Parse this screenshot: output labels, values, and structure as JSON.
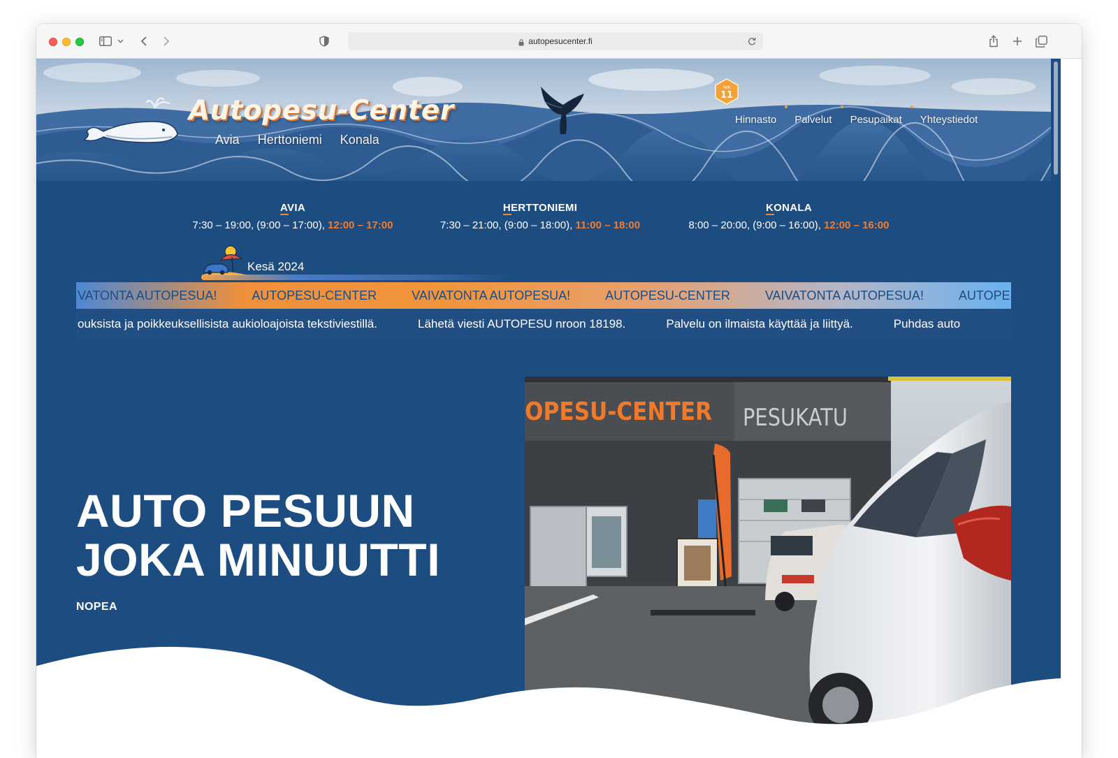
{
  "browser": {
    "url": "autopesucenter.fi"
  },
  "brand": {
    "title": "Autopesu-Center",
    "locations": [
      "Avia",
      "Herttoniemi",
      "Konala"
    ],
    "badge_top": "FAIR",
    "badge_num": "11"
  },
  "nav": {
    "items": [
      "Hinnasto",
      "Palvelut",
      "Pesupaikat",
      "Yhteystiedot"
    ]
  },
  "hours": [
    {
      "name": "AVIA",
      "times": "7:30 – 19:00, (9:00 – 17:00),",
      "highlight": "12:00 – 17:00"
    },
    {
      "name": "HERTTONIEMI",
      "times": "7:30 – 21:00, (9:00 – 18:00),",
      "highlight": "11:00 – 18:00"
    },
    {
      "name": "KONALA",
      "times": "8:00 – 20:00, (9:00 – 16:00),",
      "highlight": "12:00 – 16:00"
    }
  ],
  "summer": {
    "label": "Kesä 2024"
  },
  "marquee_top": [
    "VATONTA AUTOPESUA!",
    "AUTOPESU-CENTER",
    "VAIVATONTA AUTOPESUA!",
    "AUTOPESU-CENTER",
    "VAIVATONTA AUTOPESUA!",
    "AUTOPESU-"
  ],
  "marquee_bottom": [
    "ouksista ja poikkeuksellisista aukioloajoista tekstiviestillä.",
    "Lähetä viesti AUTOPESU nroon 18198.",
    "Palvelu on ilmaista käyttää ja liittyä.",
    "Puhdas auto"
  ],
  "hero": {
    "line1": "AUTO PESUUN",
    "line2": "JOKA MINUUTTI",
    "subtitle": "NOPEA"
  },
  "photo": {
    "sign_left": "OPESU-CENTER",
    "sign_right": "PESUKATU"
  }
}
